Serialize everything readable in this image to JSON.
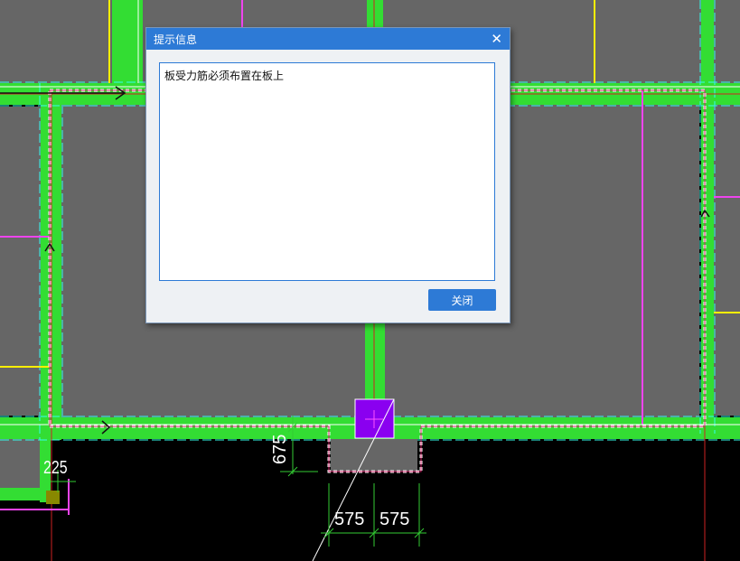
{
  "dialog": {
    "title": "提示信息",
    "close_icon": "close-icon",
    "message": "板受力筋必须布置在板上",
    "close_button_label": "关闭"
  },
  "drawing": {
    "dimensions": {
      "left_vertical": "225",
      "middle_vertical": "675",
      "bottom_left": "575",
      "bottom_right": "575"
    },
    "colors": {
      "background": "#000000",
      "slab_fill": "#666666",
      "beam_green": "#33dd33",
      "wall_magenta": "#ee44ee",
      "line_yellow": "#ffee00",
      "column_purple": "#8a00f0",
      "dim_green": "#33cc33"
    }
  }
}
